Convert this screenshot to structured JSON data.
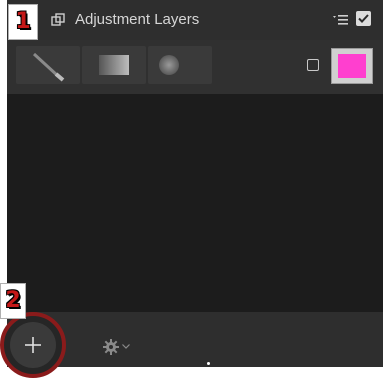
{
  "panel": {
    "title": "Adjustment Layers",
    "header_icon": "layers-icon",
    "menu_icon": "panel-menu-icon",
    "enabled_checkbox_checked": true
  },
  "toolbar": {
    "tools": [
      {
        "name": "brush-tool",
        "icon": "brush-icon"
      },
      {
        "name": "gradient-tool",
        "icon": "gradient-icon"
      },
      {
        "name": "radial-tool",
        "icon": "radial-gradient-icon"
      }
    ],
    "overlay_checkbox_checked": false,
    "overlay_color": "#ff3fcf"
  },
  "footer": {
    "add_button_icon": "plus-icon",
    "settings_icon": "gear-icon",
    "settings_menu_icon": "chevron-down-icon"
  },
  "annotations": {
    "step_1": "1",
    "step_2": "2",
    "highlight_color": "#8a1b1b",
    "label_color": "#c41818"
  }
}
